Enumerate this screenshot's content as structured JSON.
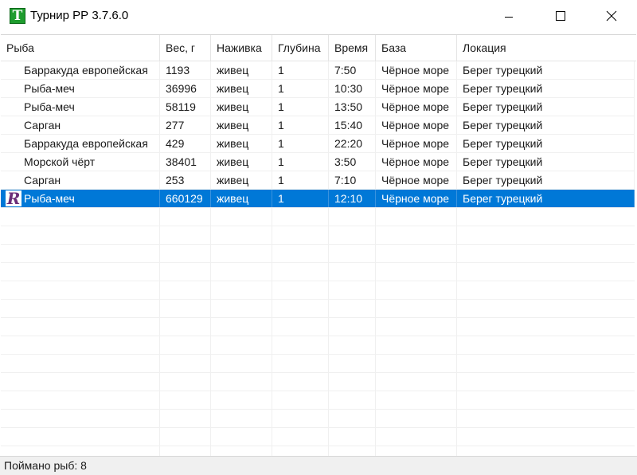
{
  "window": {
    "title": "Турнир РР 3.7.6.0",
    "icon_letter": "T",
    "icon_color": "#1e9c2e"
  },
  "columns": [
    "Рыба",
    "Вес, г",
    "Наживка",
    "Глубина",
    "Время",
    "База",
    "Локация"
  ],
  "rows": [
    [
      "Барракуда европейская",
      "1193",
      "живец",
      "1",
      "7:50",
      "Чёрное море",
      "Берег турецкий"
    ],
    [
      "Рыба-меч",
      "36996",
      "живец",
      "1",
      "10:30",
      "Чёрное море",
      "Берег турецкий"
    ],
    [
      "Рыба-меч",
      "58119",
      "живец",
      "1",
      "13:50",
      "Чёрное море",
      "Берег турецкий"
    ],
    [
      "Сарган",
      "277",
      "живец",
      "1",
      "15:40",
      "Чёрное море",
      "Берег турецкий"
    ],
    [
      "Барракуда европейская",
      "429",
      "живец",
      "1",
      "22:20",
      "Чёрное море",
      "Берег турецкий"
    ],
    [
      "Морской чёрт",
      "38401",
      "живец",
      "1",
      "3:50",
      "Чёрное море",
      "Берег турецкий"
    ],
    [
      "Сарган",
      "253",
      "живец",
      "1",
      "7:10",
      "Чёрное море",
      "Берег турецкий"
    ],
    [
      "Рыба-меч",
      "660129",
      "живец",
      "1",
      "12:10",
      "Чёрное море",
      "Берег турецкий"
    ]
  ],
  "selected_row": 7,
  "record_icon": {
    "letter": "R",
    "color": "#6b2d78"
  },
  "selection_color": "#0078d7",
  "status": {
    "text": "Поймано рыб: 8"
  }
}
